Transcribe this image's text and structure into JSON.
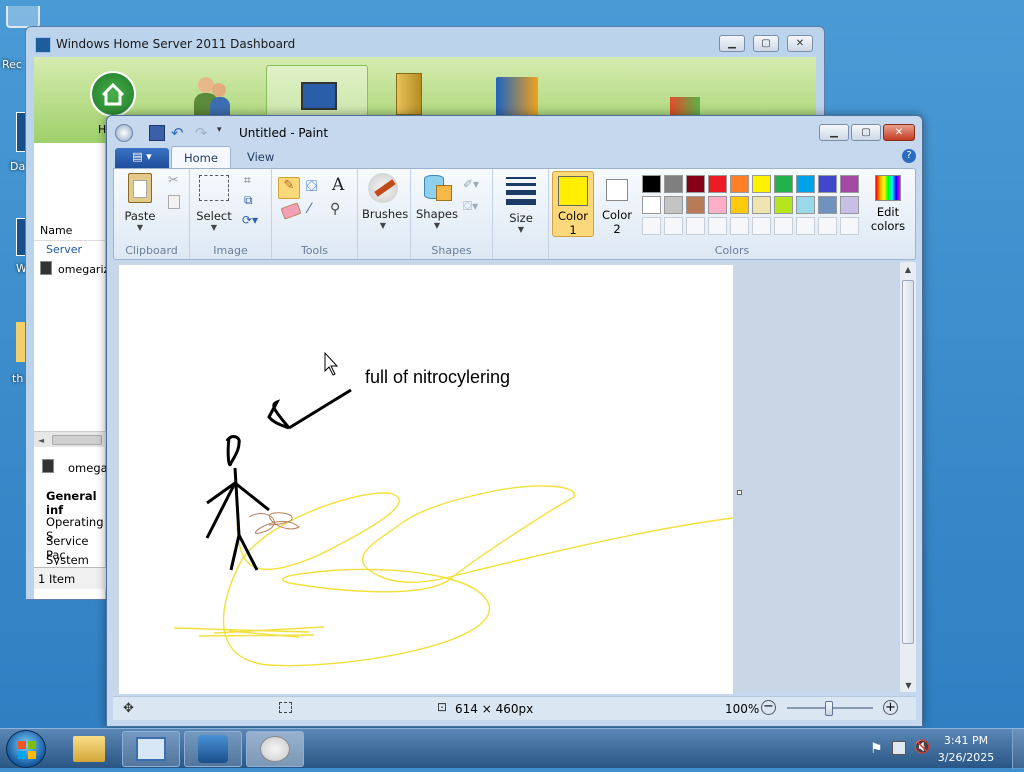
{
  "desktop": {
    "icons": [
      {
        "name": "recycle-bin",
        "label": "Rec"
      },
      {
        "name": "dashboard-shortcut",
        "label": "Da"
      },
      {
        "name": "shortcut-w",
        "label": "W"
      },
      {
        "name": "folder-th",
        "label": "th"
      }
    ]
  },
  "dashboard": {
    "title": "Windows Home Server 2011 Dashboard",
    "home_label": "H",
    "list_header": "Name",
    "group": "Server",
    "row": "omegariz",
    "detail_name": "omega",
    "general_info": "General inf",
    "fields": [
      "Operating S",
      "Service Pac",
      "System typ"
    ],
    "status": "1 Item"
  },
  "paint": {
    "title": "Untitled - Paint",
    "tabs": [
      "Home",
      "View"
    ],
    "groups": {
      "clipboard": {
        "label": "Clipboard",
        "paste": "Paste"
      },
      "image": {
        "label": "Image",
        "select": "Select"
      },
      "tools": {
        "label": "Tools"
      },
      "brushes": {
        "label": "Brushes"
      },
      "shapes": {
        "label": "Shapes",
        "button": "Shapes"
      },
      "size": {
        "label": "Size"
      },
      "colors": {
        "label": "Colors",
        "color1_line1": "Color",
        "color1_line2": "1",
        "color2_line1": "Color",
        "color2_line2": "2",
        "edit_line1": "Edit",
        "edit_line2": "colors",
        "color1": "#ffee00",
        "color2": "#ffffff",
        "palette_row1": [
          "#000000",
          "#7f7f7f",
          "#880015",
          "#ed1c24",
          "#ff7f27",
          "#fff200",
          "#22b14c",
          "#00a2e8",
          "#3f48cc",
          "#a349a4"
        ],
        "palette_row2": [
          "#ffffff",
          "#c3c3c3",
          "#b97a57",
          "#ffaec9",
          "#ffc90e",
          "#efe4b0",
          "#b5e61d",
          "#99d9ea",
          "#7092be",
          "#c8bfe7"
        ]
      }
    },
    "canvas_text": "full of nitrocylering",
    "status": {
      "size": "614 × 460px",
      "zoom": "100%"
    }
  },
  "taskbar": {
    "time": "3:41 PM",
    "date": "3/26/2025"
  }
}
